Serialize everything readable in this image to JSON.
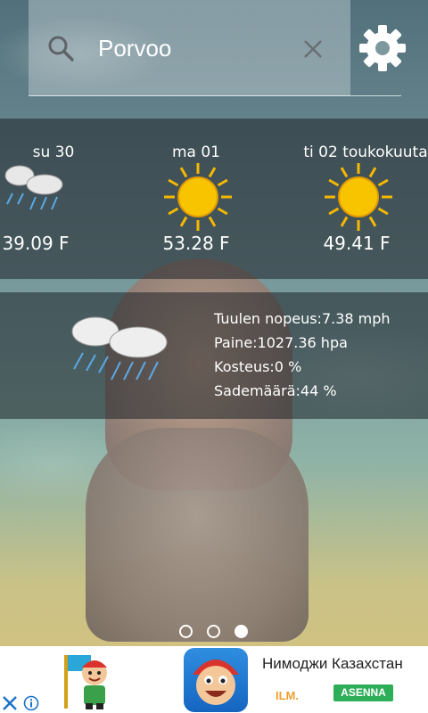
{
  "search": {
    "city": "Porvoo",
    "icon": "search-icon",
    "clear_icon": "close-icon",
    "settings_icon": "gear-icon"
  },
  "forecast": [
    {
      "day": "su 30",
      "temp": "39.09 F",
      "condition": "rain-clouds"
    },
    {
      "day": "ma 01",
      "temp": "53.28 F",
      "condition": "sun"
    },
    {
      "day": "ti 02 toukokuuta",
      "temp": "49.41 F",
      "condition": "sun"
    }
  ],
  "details": {
    "condition": "rain-clouds",
    "wind": "Tuulen nopeus:7.38 mph",
    "pressure": "Paine:1027.36 hpa",
    "humidity": "Kosteus:0 %",
    "precipitation": "Sademäärä:44 %"
  },
  "pager": {
    "pages": 3,
    "active_index": 2
  },
  "ad": {
    "title": "Нимоджи Казахстан",
    "free_label": "ILM.",
    "install_label": "ASENNA",
    "install_color": "#2fae5a",
    "free_color": "#f0a030"
  },
  "colors": {
    "sun": "#f5b800",
    "rain": "#5aa8e6"
  }
}
